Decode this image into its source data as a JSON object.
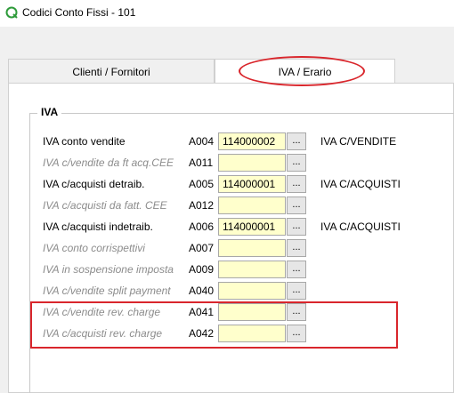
{
  "window": {
    "title": "Codici Conto Fissi - 101",
    "icon": "q-logo-icon"
  },
  "tabs": [
    {
      "label": "Clienti / Fornitori",
      "active": false
    },
    {
      "label": "IVA / Erario",
      "active": true
    }
  ],
  "group": {
    "title": "IVA"
  },
  "rows": [
    {
      "label": "IVA conto vendite",
      "code": "A004",
      "value": "114000002",
      "button": "...",
      "description": "IVA C/VENDITE",
      "enabled": true
    },
    {
      "label": "IVA c/vendite da ft acq.CEE",
      "code": "A011",
      "value": "",
      "button": "...",
      "description": "",
      "enabled": false
    },
    {
      "label": "IVA c/acquisti detraib.",
      "code": "A005",
      "value": "114000001",
      "button": "...",
      "description": "IVA C/ACQUISTI",
      "enabled": true
    },
    {
      "label": "IVA c/acquisti da fatt. CEE",
      "code": "A012",
      "value": "",
      "button": "...",
      "description": "",
      "enabled": false
    },
    {
      "label": "IVA c/acquisti indetraib.",
      "code": "A006",
      "value": "114000001",
      "button": "...",
      "description": "IVA C/ACQUISTI",
      "enabled": true
    },
    {
      "label": "IVA conto corrispettivi",
      "code": "A007",
      "value": "",
      "button": "...",
      "description": "",
      "enabled": false
    },
    {
      "label": "IVA in sospensione imposta",
      "code": "A009",
      "value": "",
      "button": "...",
      "description": "",
      "enabled": false
    },
    {
      "label": "IVA c/vendite split payment",
      "code": "A040",
      "value": "",
      "button": "...",
      "description": "",
      "enabled": false
    },
    {
      "label": "IVA c/vendite rev. charge",
      "code": "A041",
      "value": "",
      "button": "...",
      "description": "",
      "enabled": false
    },
    {
      "label": "IVA c/acquisti rev. charge",
      "code": "A042",
      "value": "",
      "button": "...",
      "description": "",
      "enabled": false
    }
  ],
  "annotation_color": "#d9262c",
  "field_color": "#ffffcc"
}
